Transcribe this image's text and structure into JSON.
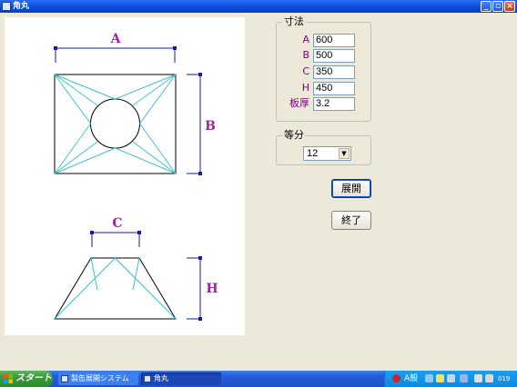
{
  "window": {
    "title": "角丸",
    "icon": "app-window-icon"
  },
  "drawing": {
    "top_view": {
      "width_label": "A",
      "depth_label": "B"
    },
    "side_view": {
      "top_label": "C",
      "height_label": "H"
    },
    "colors": {
      "outline": "#000000",
      "fold_lines": "#3ec3cf",
      "dimension": "#1a1aa8",
      "label": "#a0259e"
    }
  },
  "dimensions": {
    "legend": "寸法",
    "fields": [
      {
        "label": "A",
        "value": "600"
      },
      {
        "label": "B",
        "value": "500"
      },
      {
        "label": "C",
        "value": "350"
      },
      {
        "label": "H",
        "value": "450"
      },
      {
        "label": "板厚",
        "value": "3.2"
      }
    ]
  },
  "division": {
    "legend": "等分",
    "selected": "12"
  },
  "buttons": {
    "expand": "展開",
    "exit": "終了"
  },
  "taskbar": {
    "start_label": "スタート",
    "tasks": [
      {
        "label": "製缶展開システム",
        "icon": "app-icon"
      },
      {
        "label": "角丸",
        "icon": "app-window-icon"
      }
    ],
    "ime": "A般",
    "clock": "019"
  }
}
